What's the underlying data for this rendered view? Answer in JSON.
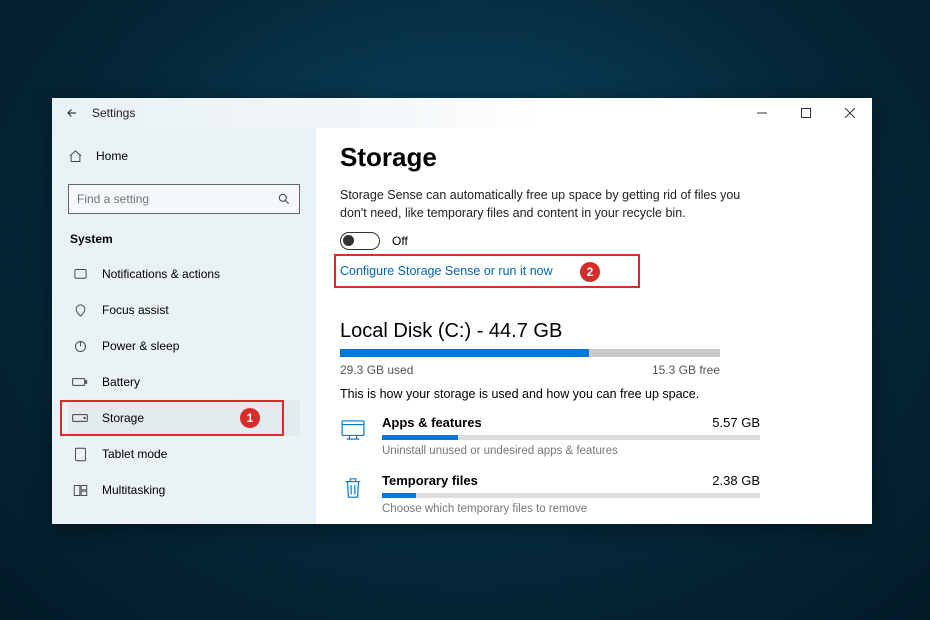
{
  "window": {
    "title": "Settings"
  },
  "sidebar": {
    "home": "Home",
    "search_placeholder": "Find a setting",
    "section": "System",
    "items": [
      {
        "key": "notifications",
        "label": "Notifications & actions"
      },
      {
        "key": "focus",
        "label": "Focus assist"
      },
      {
        "key": "power",
        "label": "Power & sleep"
      },
      {
        "key": "battery",
        "label": "Battery"
      },
      {
        "key": "storage",
        "label": "Storage",
        "selected": true
      },
      {
        "key": "tablet",
        "label": "Tablet mode"
      },
      {
        "key": "multitasking",
        "label": "Multitasking"
      }
    ]
  },
  "main": {
    "heading": "Storage",
    "sense_desc": "Storage Sense can automatically free up space by getting rid of files you don't need, like temporary files and content in your recycle bin.",
    "toggle_state": "Off",
    "configure_link": "Configure Storage Sense or run it now",
    "disk": {
      "heading": "Local Disk (C:) - 44.7 GB",
      "used_label": "29.3 GB used",
      "free_label": "15.3 GB free",
      "used_pct": 65.5
    },
    "usage_desc": "This is how your storage is used and how you can free up space.",
    "categories": [
      {
        "name": "Apps & features",
        "size": "5.57 GB",
        "hint": "Uninstall unused or undesired apps & features",
        "pct": 20,
        "icon": "apps"
      },
      {
        "name": "Temporary files",
        "size": "2.38 GB",
        "hint": "Choose which temporary files to remove",
        "pct": 9,
        "icon": "trash"
      }
    ]
  },
  "annotations": {
    "badge1": "1",
    "badge2": "2"
  }
}
